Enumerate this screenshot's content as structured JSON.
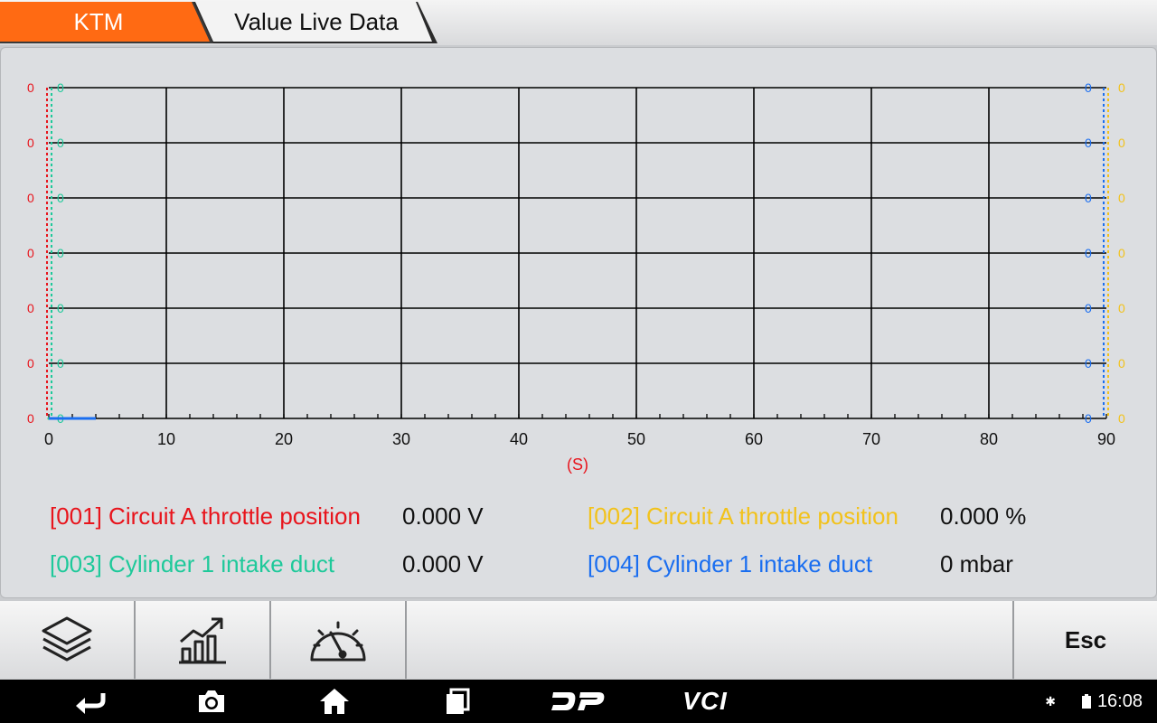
{
  "header": {
    "tab_brand": "KTM",
    "tab_title": "Value Live Data",
    "brand_color": "#ff6a13"
  },
  "chart_data": {
    "type": "line",
    "xlabel": "(S)",
    "xlim": [
      0,
      90
    ],
    "x_ticks": [
      "0",
      "10",
      "20",
      "30",
      "40",
      "50",
      "60",
      "70",
      "80",
      "90"
    ],
    "left_axis_labels": [
      "0",
      "0",
      "0",
      "0",
      "0",
      "0",
      "0"
    ],
    "right_axis_labels": [
      "0",
      "0",
      "0",
      "0",
      "0",
      "0",
      "0"
    ],
    "grid": true,
    "series": [
      {
        "name": "[001] Circuit A throttle position",
        "color": "#e8141c",
        "x": [
          0
        ],
        "y": [
          0
        ]
      },
      {
        "name": "[002] Circuit A throttle position",
        "color": "#f2c21b",
        "x": [
          0
        ],
        "y": [
          0
        ]
      },
      {
        "name": "[003] Cylinder 1 intake duct",
        "color": "#1ec99a",
        "x": [
          0
        ],
        "y": [
          0
        ]
      },
      {
        "name": "[004] Cylinder 1 intake duct",
        "color": "#1a6ef0",
        "x": [
          0,
          4
        ],
        "y": [
          0,
          0
        ]
      }
    ]
  },
  "legend": {
    "items": [
      {
        "label": "[001] Circuit A throttle position",
        "value": "0.000 V",
        "color": "#e8141c"
      },
      {
        "label": "[002] Circuit A throttle position",
        "value": "0.000 %",
        "color": "#f2c21b"
      },
      {
        "label": "[003] Cylinder 1 intake duct",
        "value": "0.000 V",
        "color": "#1ec99a"
      },
      {
        "label": "[004] Cylinder 1 intake duct",
        "value": "0 mbar",
        "color": "#1a6ef0"
      }
    ]
  },
  "toolbar": {
    "icons": [
      "layers-icon",
      "graph-trend-icon",
      "gauge-icon"
    ],
    "esc_label": "Esc"
  },
  "navbar": {
    "icons": [
      "back-icon",
      "camera-icon",
      "home-icon",
      "recent-apps-icon",
      "dp-icon",
      "vci-icon"
    ],
    "dp_label": "DP",
    "vci_label": "VCI",
    "time": "16:08"
  }
}
